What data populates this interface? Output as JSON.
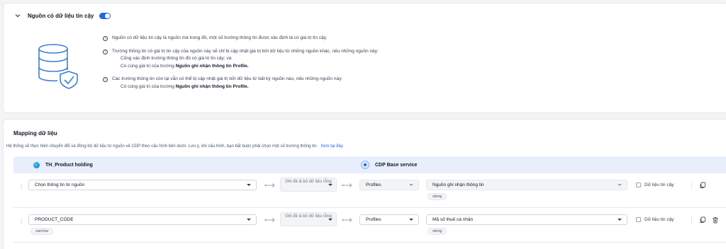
{
  "trusted_source": {
    "title": "Nguồn có dữ liệu tin cậy",
    "toggle_on": true,
    "info": [
      {
        "text": "Nguồn có dữ liệu tin cậy là nguồn mà trong đó, một số trường thông tin được xác định là có giá trị tin cậy."
      },
      {
        "text": "Trường thông tin có giá trị tin cậy của nguồn này sẽ chỉ bị cập nhật giá trị bởi dữ liệu từ những nguồn khác, nếu những nguồn này:",
        "sub1": "Cũng xác định trường thông tin đó có giá trị tin cậy; và",
        "sub2_prefix": "Có cùng giá trị của trường ",
        "sub2_bold": "Nguồn ghi nhận thông tin Profile."
      },
      {
        "text": "Các trường thông tin còn lại vẫn có thể bị cập nhật giá trị bởi dữ liệu từ bất kỳ nguồn nào, nếu những nguồn này:",
        "sub1_prefix": "Có cùng giá trị của trường ",
        "sub1_bold": "Nguồn ghi nhận thông tin Profile."
      }
    ]
  },
  "mapping": {
    "title": "Mapping dữ liệu",
    "description": "Hệ thống sẽ thực hiện chuyển đổi và đồng bộ dữ liệu từ nguồn về CDP theo cấu hình bên dưới. Lưu ý, khi cấu hình, bạn bắt buộc phải chọn một số trường thông tin.",
    "link": "Xem tại đây",
    "source_name": "TH_Product holding",
    "target_name": "CDP Base service",
    "rows": [
      {
        "source_field": "Chọn thông tin từ nguồn",
        "source_type": "",
        "rule": "Ghi đè & bỏ dữ liệu rỗng",
        "group": "Profiles",
        "target_field": "Nguồn ghi nhận thông tin",
        "target_type": "string",
        "trusted_label": "Dữ liệu tin cậy"
      },
      {
        "source_field": "PRODUCT_CODE",
        "source_type": "varchar",
        "rule": "Ghi đè & bỏ dữ liệu rỗng",
        "group": "Profiles",
        "target_field": "Mã số thuế cá nhân",
        "target_type": "string",
        "trusted_label": "Dữ liệu tin cậy"
      }
    ]
  },
  "colors": {
    "accent": "#2563eb",
    "header_bg": "#e8eefb",
    "illustration": "#3b7fd6"
  }
}
